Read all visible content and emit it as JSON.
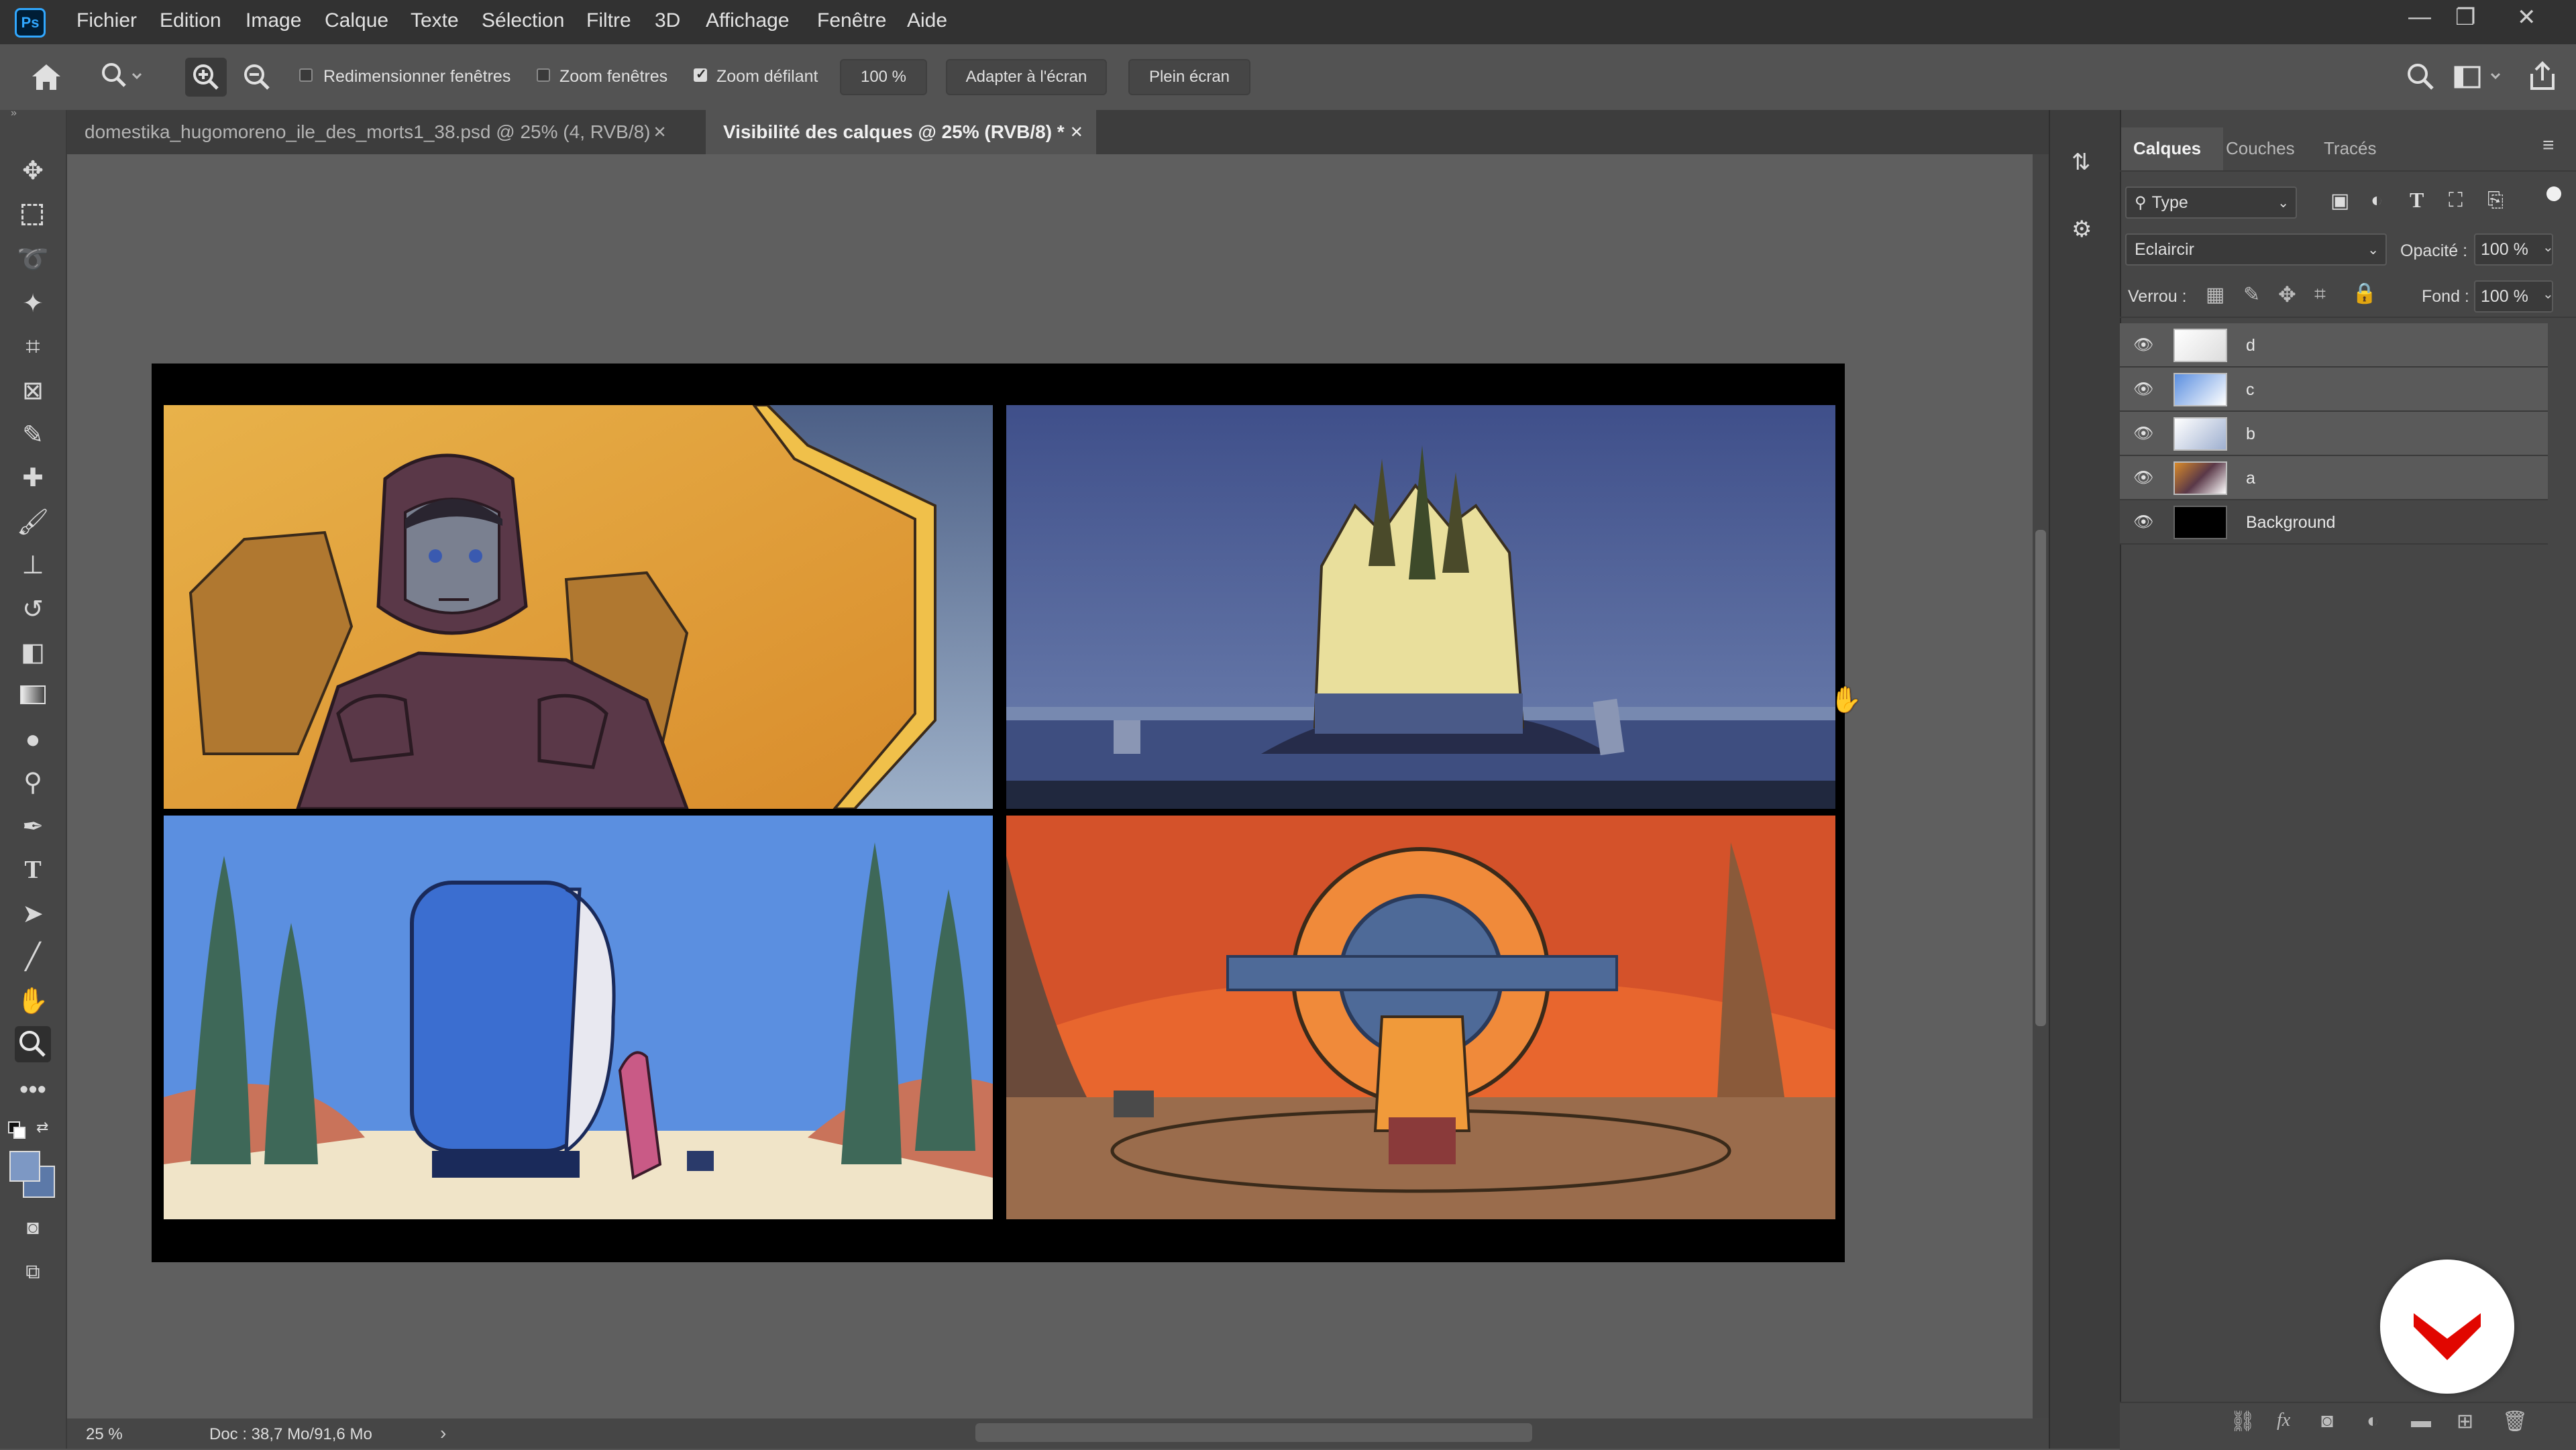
{
  "app": {
    "logo": "Ps"
  },
  "menu": [
    "Fichier",
    "Edition",
    "Image",
    "Calque",
    "Texte",
    "Sélection",
    "Filtre",
    "3D",
    "Affichage",
    "Fenêtre",
    "Aide"
  ],
  "window_controls": {
    "minimize": "—",
    "restore": "❐",
    "close": "✕"
  },
  "options": {
    "resize_windows": "Redimensionner fenêtres",
    "zoom_windows": "Zoom fenêtres",
    "scrubby_zoom": "Zoom défilant",
    "zoom_value": "100 %",
    "fit_screen": "Adapter à l'écran",
    "full_screen": "Plein écran",
    "checks": {
      "resize_windows": false,
      "zoom_windows": false,
      "scrubby_zoom": true
    }
  },
  "tabs": [
    {
      "label": "domestika_hugomoreno_ile_des_morts1_38.psd @ 25% (4, RVB/8)",
      "close": "✕",
      "active": false
    },
    {
      "label": "Visibilité des calques @ 25% (RVB/8) *",
      "close": "✕",
      "active": true
    }
  ],
  "status": {
    "zoom": "25 %",
    "doc": "Doc : 38,7 Mo/91,6 Mo",
    "arrow": "›"
  },
  "layers_panel": {
    "tabs": [
      "Calques",
      "Couches",
      "Tracés"
    ],
    "filter_type": "Type",
    "blend_mode": "Eclaircir",
    "opacity_label": "Opacité :",
    "opacity_value": "100 %",
    "lock_label": "Verrou :",
    "fill_label": "Fond :",
    "fill_value": "100 %",
    "layers": [
      {
        "name": "d",
        "visible": true,
        "selected": true
      },
      {
        "name": "c",
        "visible": true,
        "selected": true
      },
      {
        "name": "b",
        "visible": true,
        "selected": true
      },
      {
        "name": "a",
        "visible": true,
        "selected": true
      },
      {
        "name": "Background",
        "visible": true,
        "selected": false
      }
    ]
  },
  "colors": {
    "accent": "#31a8ff",
    "panel_bg": "#464646",
    "canvas_bg": "#5f5f5f",
    "brand_red": "#e10600"
  }
}
